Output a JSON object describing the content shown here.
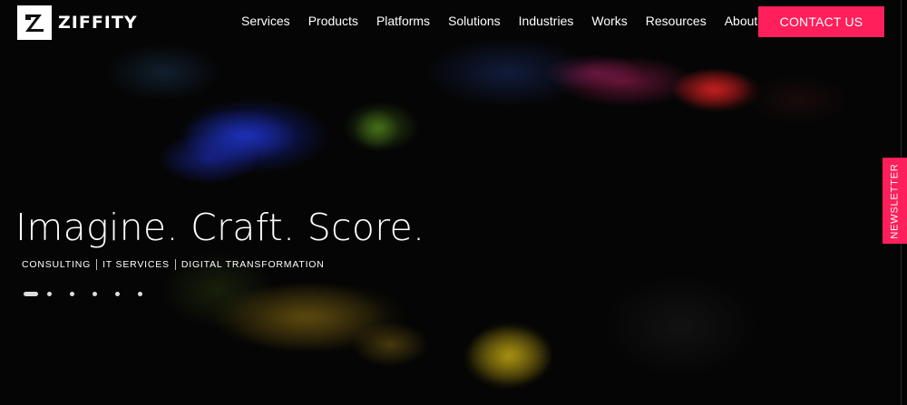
{
  "brand": {
    "name": "ZIFFITY",
    "logo_icon": "z-logo-icon"
  },
  "nav": {
    "items": [
      {
        "label": "Services"
      },
      {
        "label": "Products"
      },
      {
        "label": "Platforms"
      },
      {
        "label": "Solutions"
      },
      {
        "label": "Industries"
      },
      {
        "label": "Works"
      },
      {
        "label": "Resources"
      },
      {
        "label": "About"
      }
    ],
    "contact_label": "CONTACT US"
  },
  "hero": {
    "headline": "Imagine. Craft. Score.",
    "tags": [
      "CONSULTING",
      "IT SERVICES",
      "DIGITAL TRANSFORMATION"
    ],
    "slides": {
      "count": 6,
      "active": 1
    }
  },
  "newsletter": {
    "label": "NEWSLETTER"
  },
  "colors": {
    "accent": "#ff1f5b",
    "background": "#050505",
    "text": "#ffffff"
  }
}
